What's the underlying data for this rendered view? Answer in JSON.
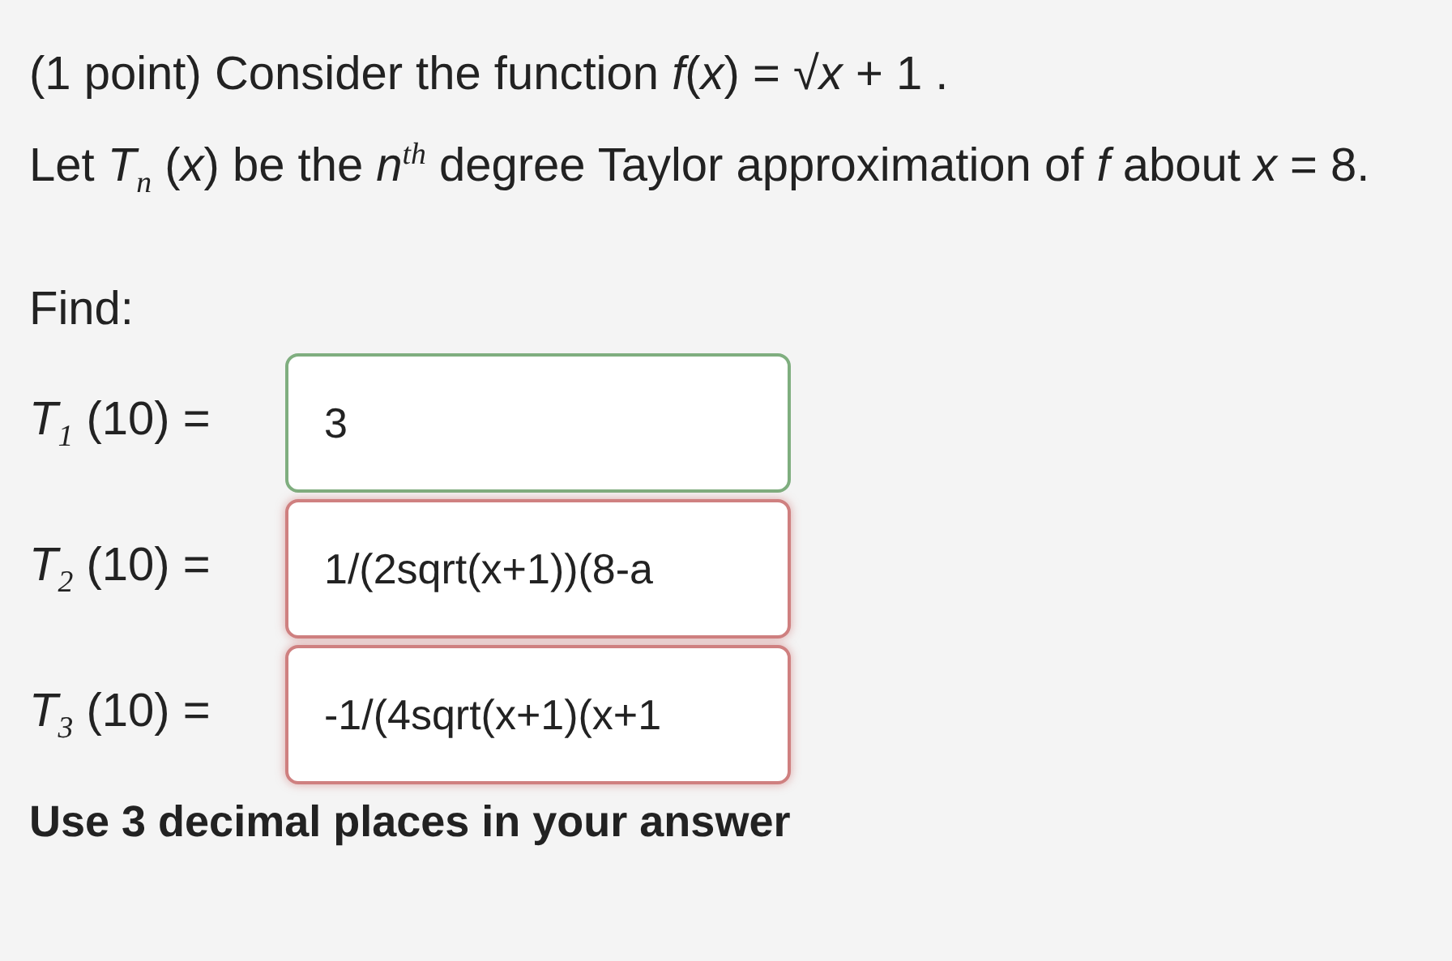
{
  "problem": {
    "lines": [
      "(1 point) Consider the function *f*(*x*) = √*x* + 1 .",
      "Let *T*$_{n}$ (*x*) be the *n*$^{th}$ degree Taylor approximation of *f* about *x* = 8."
    ]
  },
  "prompt": "Find:",
  "answers": [
    {
      "label": "*T*$_{1}$ (10) =",
      "value": "3",
      "correct": true
    },
    {
      "label": "*T*$_{2}$ (10) =",
      "value": "1/(2sqrt(x+1))(8-a",
      "correct": false
    },
    {
      "label": "*T*$_{3}$ (10) =",
      "value": "-1/(4sqrt(x+1)(x+1",
      "correct": false
    }
  ],
  "note": "Use 3 decimal places in your answer"
}
